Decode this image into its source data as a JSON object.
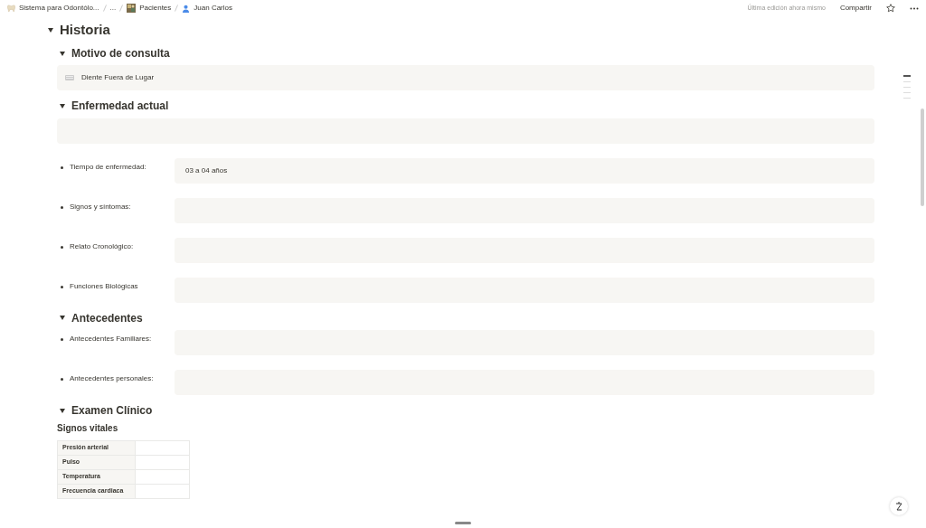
{
  "breadcrumbs": [
    {
      "label": "Sistema para Odontólo..."
    },
    {
      "label": "..."
    },
    {
      "label": "Pacientes"
    },
    {
      "label": "Juan Carlos"
    }
  ],
  "topbar": {
    "edited": "Última edición ahora mismo",
    "share": "Compartir",
    "favorite": false
  },
  "page": {
    "title": "Historia",
    "expanded": true,
    "sections": [
      {
        "title": "Motivo de consulta",
        "expanded": true,
        "blocks": [
          {
            "kind": "callout",
            "text": "Diente Fuera de Lugar"
          }
        ]
      },
      {
        "title": "Enfermedad actual",
        "expanded": true,
        "blocks": [
          {
            "kind": "empty"
          },
          {
            "kind": "field",
            "label": "Tiempo de enfermedad:",
            "value": "03 a 04 años"
          },
          {
            "kind": "field",
            "label": "Signos y síntomas:"
          },
          {
            "kind": "field",
            "label": "Relato Cronológico:"
          },
          {
            "kind": "field",
            "label": "Funciones Biológicas"
          }
        ]
      },
      {
        "title": "Antecedentes",
        "expanded": true,
        "blocks": [
          {
            "kind": "field",
            "label": "Antecedentes Familiares:"
          },
          {
            "kind": "field",
            "label": "Antecedentes personales:"
          }
        ]
      },
      {
        "title": "Examen Clínico",
        "expanded": true,
        "blocks": [
          {
            "kind": "table",
            "title": "Signos vitales",
            "rows": [
              "Presión arterial",
              "Pulso",
              "Temperatura",
              "Frecuencia cardiaca"
            ]
          }
        ]
      }
    ]
  }
}
